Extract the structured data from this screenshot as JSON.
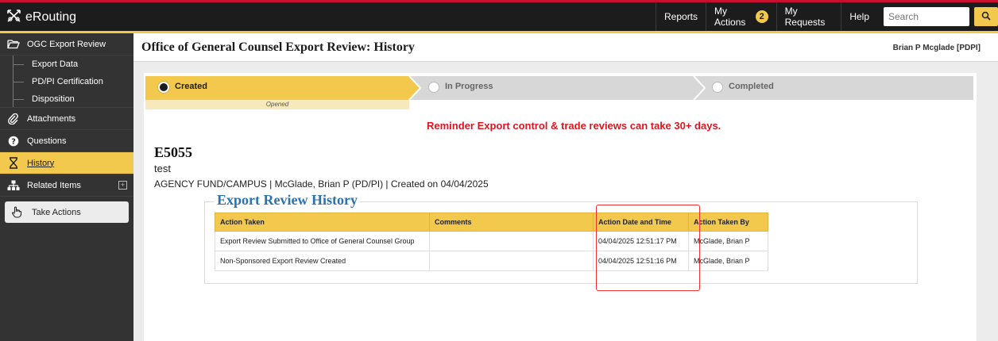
{
  "app": {
    "name": "eRouting"
  },
  "topnav": {
    "reports": "Reports",
    "my_actions": "My Actions",
    "my_actions_count": "2",
    "my_requests": "My Requests",
    "help": "Help",
    "search_placeholder": "Search"
  },
  "sidebar": {
    "section": "OGC Export Review",
    "subitems": [
      "Export Data",
      "PD/PI Certification",
      "Disposition"
    ],
    "items": {
      "attachments": "Attachments",
      "questions": "Questions",
      "history": "History",
      "related_items": "Related Items"
    },
    "take_actions": "Take Actions"
  },
  "header": {
    "title": "Office of General Counsel Export Review: History",
    "user": "Brian P Mcglade [PDPI]"
  },
  "progress": {
    "stages": [
      "Created",
      "In Progress",
      "Completed"
    ],
    "current_note": "Opened"
  },
  "reminder": "Reminder Export control & trade reviews can take 30+ days.",
  "record": {
    "id": "E5055",
    "description": "test",
    "meta": "AGENCY FUND/CAMPUS | McGlade, Brian P (PD/PI) | Created on 04/04/2025"
  },
  "history": {
    "title": "Export Review History",
    "columns": [
      "Action Taken",
      "Comments",
      "Action Date and Time",
      "Action Taken By"
    ],
    "rows": [
      [
        "Export Review Submitted to Office of General Counsel Group",
        "",
        "04/04/2025 12:51:17 PM",
        "McGlade, Brian P"
      ],
      [
        "Non-Sponsored Export Review Created",
        "",
        "04/04/2025 12:51:16 PM",
        "McGlade, Brian P"
      ]
    ]
  },
  "colors": {
    "accent_yellow": "#f2c94c",
    "topbar": "#1c1c1c",
    "sidebar": "#333333",
    "reminder_red": "#e0141e",
    "heading_blue": "#2a72b0",
    "highlight_red": "#e33333"
  },
  "icons": {
    "brand": "crossed-arrows-icon",
    "search": "search-icon",
    "ogc": "folder-open-icon",
    "attachments": "paperclip-icon",
    "questions": "question-circle-icon",
    "history": "hourglass-icon",
    "related": "sitemap-icon",
    "expand": "plus-square-icon",
    "take_actions": "hand-pointer-icon"
  }
}
